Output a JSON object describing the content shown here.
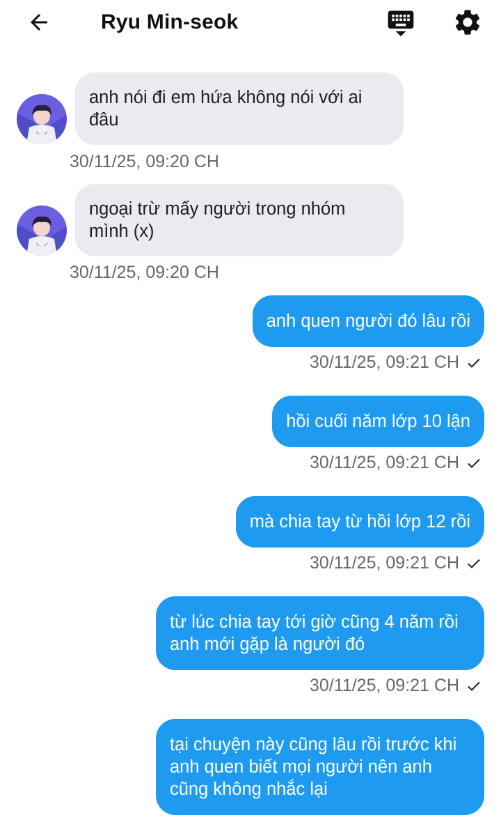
{
  "header": {
    "title": "Ryu Min-seok",
    "back_icon": "arrow-left-icon",
    "keyboard_icon": "keyboard-hide-icon",
    "settings_icon": "gear-icon"
  },
  "colors": {
    "incoming_bubble": "#e9ebee",
    "outgoing_bubble": "#1e9bf0",
    "timestamp": "#65676b"
  },
  "messages": [
    {
      "direction": "incoming",
      "text": "anh nói đi em hứa không nói với ai đâu",
      "time": "30/11/25, 09:20 CH"
    },
    {
      "direction": "incoming",
      "text": "ngoại trừ mấy người trong nhóm mình (x)",
      "time": "30/11/25, 09:20 CH"
    },
    {
      "direction": "outgoing",
      "text": "anh quen người đó lâu rồi",
      "time": "30/11/25, 09:21 CH",
      "status": "sent"
    },
    {
      "direction": "outgoing",
      "text": "hồi cuối năm lớp 10 lận",
      "time": "30/11/25, 09:21 CH",
      "status": "sent"
    },
    {
      "direction": "outgoing",
      "text": "mà chia tay từ hồi lớp 12 rồi",
      "time": "30/11/25, 09:21 CH",
      "status": "sent"
    },
    {
      "direction": "outgoing",
      "text": "từ lúc chia tay tới giờ cũng 4 năm rồi anh mới gặp là người đó",
      "time": "30/11/25, 09:21 CH",
      "status": "sent"
    },
    {
      "direction": "outgoing",
      "text": "tại chuyện này cũng lâu rồi trước khi anh quen biết mọi người nên anh cũng không nhắc lại"
    }
  ]
}
